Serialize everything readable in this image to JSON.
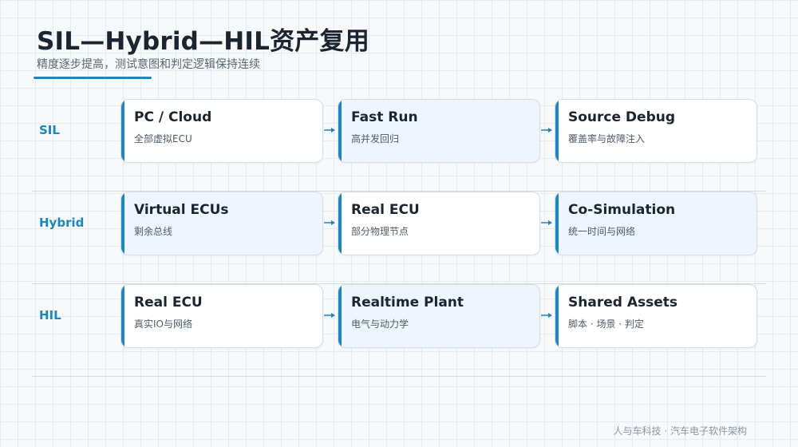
{
  "header": {
    "title": "SIL—Hybrid—HIL资产复用",
    "subtitle": "精度逐步提高，测试意图和判定逻辑保持连续"
  },
  "rows": [
    {
      "label": "SIL",
      "cards": [
        {
          "title": "PC / Cloud",
          "sub": "全部虚拟ECU"
        },
        {
          "title": "Fast Run",
          "sub": "高并发回归"
        },
        {
          "title": "Source Debug",
          "sub": "覆盖率与故障注入"
        }
      ]
    },
    {
      "label": "Hybrid",
      "cards": [
        {
          "title": "Virtual ECUs",
          "sub": "剩余总线"
        },
        {
          "title": "Real ECU",
          "sub": "部分物理节点"
        },
        {
          "title": "Co-Simulation",
          "sub": "统一时间与网络"
        }
      ]
    },
    {
      "label": "HIL",
      "cards": [
        {
          "title": "Real ECU",
          "sub": "真实IO与网络"
        },
        {
          "title": "Realtime Plant",
          "sub": "电气与动力学"
        },
        {
          "title": "Shared Assets",
          "sub": "脚本 · 场景 · 判定"
        }
      ]
    }
  ],
  "footer": "人与车科技 · 汽车电子软件架构",
  "colors": {
    "accent": "#1a87c0",
    "card_white": "#ffffff",
    "card_tint": "#eef5fd"
  }
}
